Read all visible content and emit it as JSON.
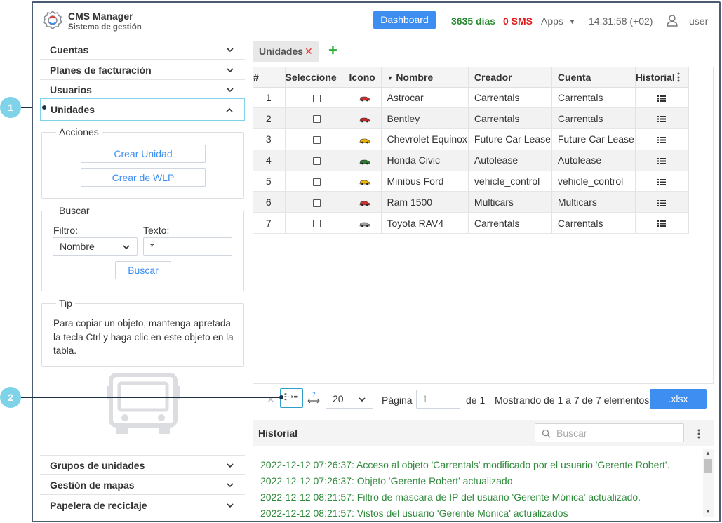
{
  "header": {
    "app_title": "CMS Manager",
    "app_subtitle": "Sistema de gestión",
    "dashboard_label": "Dashboard",
    "days": "3635 días",
    "sms": "0 SMS",
    "apps": "Apps",
    "clock": "14:31:58 (+02)",
    "user": "user"
  },
  "sidebar": {
    "top_items": [
      "Cuentas",
      "Planes de facturación",
      "Usuarios",
      "Unidades"
    ],
    "acciones": {
      "legend": "Acciones",
      "create_unit": "Crear Unidad",
      "create_wlp": "Crear de WLP"
    },
    "buscar": {
      "legend": "Buscar",
      "filter_label": "Filtro:",
      "text_label": "Texto:",
      "filter_value": "Nombre",
      "text_value": "*",
      "search_button": "Buscar"
    },
    "tip": {
      "legend": "Tip",
      "text": "Para copiar un objeto, mantenga apretada la tecla Ctrl y haga clic en este objeto en la tabla."
    },
    "bottom_items": [
      "Grupos de unidades",
      "Gestión de mapas",
      "Papelera de reciclaje"
    ]
  },
  "tabs": {
    "active_label": "Unidades"
  },
  "table": {
    "headers": {
      "num": "#",
      "select": "Seleccione",
      "icon": "Icono",
      "name": "Nombre",
      "creator": "Creador",
      "account": "Cuenta",
      "history": "Historial"
    },
    "rows": [
      {
        "num": "1",
        "name": "Astrocar",
        "creator": "Carrentals",
        "account": "Carrentals",
        "icon_color": "#d32f2f"
      },
      {
        "num": "2",
        "name": "Bentley",
        "creator": "Carrentals",
        "account": "Carrentals",
        "icon_color": "#c62828"
      },
      {
        "num": "3",
        "name": "Chevrolet Equinox",
        "creator": "Future Car Lease",
        "account": "Future Car Lease",
        "icon_color": "#f2b600"
      },
      {
        "num": "4",
        "name": "Honda Civic",
        "creator": "Autolease",
        "account": "Autolease",
        "icon_color": "#2e7d32"
      },
      {
        "num": "5",
        "name": "Minibus Ford",
        "creator": "vehicle_control",
        "account": "vehicle_control",
        "icon_color": "#f2b600"
      },
      {
        "num": "6",
        "name": "Ram 1500",
        "creator": "Multicars",
        "account": "Multicars",
        "icon_color": "#d32f2f"
      },
      {
        "num": "7",
        "name": "Toyota RAV4",
        "creator": "Carrentals",
        "account": "Carrentals",
        "icon_color": "#9e9e9e"
      }
    ]
  },
  "paging": {
    "page_size": "20",
    "page_label": "Página",
    "page_placeholder": "1",
    "of_label": "de 1",
    "info": "Mostrando de 1 a 7 de 7 elementos.",
    "export_label": ".xlsx"
  },
  "history": {
    "title": "Historial",
    "search_placeholder": "Buscar",
    "entries": [
      "2022-12-12 07:26:37: Acceso al objeto 'Carrentals' modificado por el usuario 'Gerente Robert'.",
      "2022-12-12 07:26:37: Objeto 'Gerente Robert' actualizado",
      "2022-12-12 08:21:57: Filtro de máscara de IP del usuario 'Gerente Mónica' actualizado.",
      "2022-12-12 08:21:57: Vistos del usuario 'Gerente Mónica' actualizados"
    ]
  },
  "callouts": [
    "1",
    "2"
  ],
  "colors": {
    "accent": "#3d8ef0",
    "callout": "#7fd3e8",
    "log_green": "#2f8a3b",
    "sms_red": "#e01b1b"
  }
}
